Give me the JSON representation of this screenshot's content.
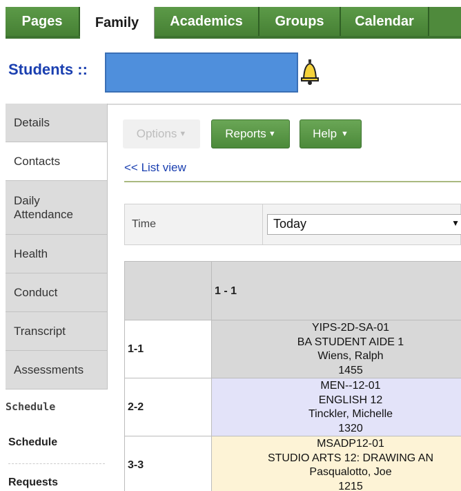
{
  "tabs": [
    {
      "label": "Pages",
      "active": false
    },
    {
      "label": "Family",
      "active": true
    },
    {
      "label": "Academics",
      "active": false
    },
    {
      "label": "Groups",
      "active": false
    },
    {
      "label": "Calendar",
      "active": false
    }
  ],
  "header": {
    "title": "Students",
    "separator": "::",
    "alert_icon": "bell-icon"
  },
  "sidebar": {
    "items": [
      {
        "label": "Details"
      },
      {
        "label": "Contacts"
      },
      {
        "label": "Daily Attendance"
      },
      {
        "label": "Health"
      },
      {
        "label": "Conduct"
      },
      {
        "label": "Transcript"
      },
      {
        "label": "Assessments"
      }
    ],
    "section_title": "Schedule",
    "subitems": [
      {
        "label": "Schedule"
      },
      {
        "label": "Requests"
      }
    ]
  },
  "toolbar": {
    "options_label": "Options",
    "reports_label": "Reports",
    "help_label": "Help",
    "list_view_link": "<< List view"
  },
  "filter": {
    "label": "Time",
    "selected": "Today"
  },
  "schedule": {
    "header_left": "",
    "header_right": "1 - 1",
    "rows": [
      {
        "period": "1-1",
        "lines": [
          "YIPS-2D-SA-01",
          "BA STUDENT AIDE 1",
          "Wiens, Ralph",
          "1455"
        ],
        "color": "#d8d8d8"
      },
      {
        "period": "2-2",
        "lines": [
          "MEN--12-01",
          "ENGLISH 12",
          "Tinckler, Michelle",
          "1320"
        ],
        "color": "#e3e3f9"
      },
      {
        "period": "3-3",
        "lines": [
          "MSADP12-01",
          "STUDIO ARTS 12: DRAWING AN",
          "Pasqualotto, Joe",
          "1215"
        ],
        "color": "#fdf3d6"
      }
    ]
  },
  "colors": {
    "tab_green": "#4f8a3c",
    "title_blue": "#1a3fb0",
    "link_blue": "#1a3fb0"
  }
}
